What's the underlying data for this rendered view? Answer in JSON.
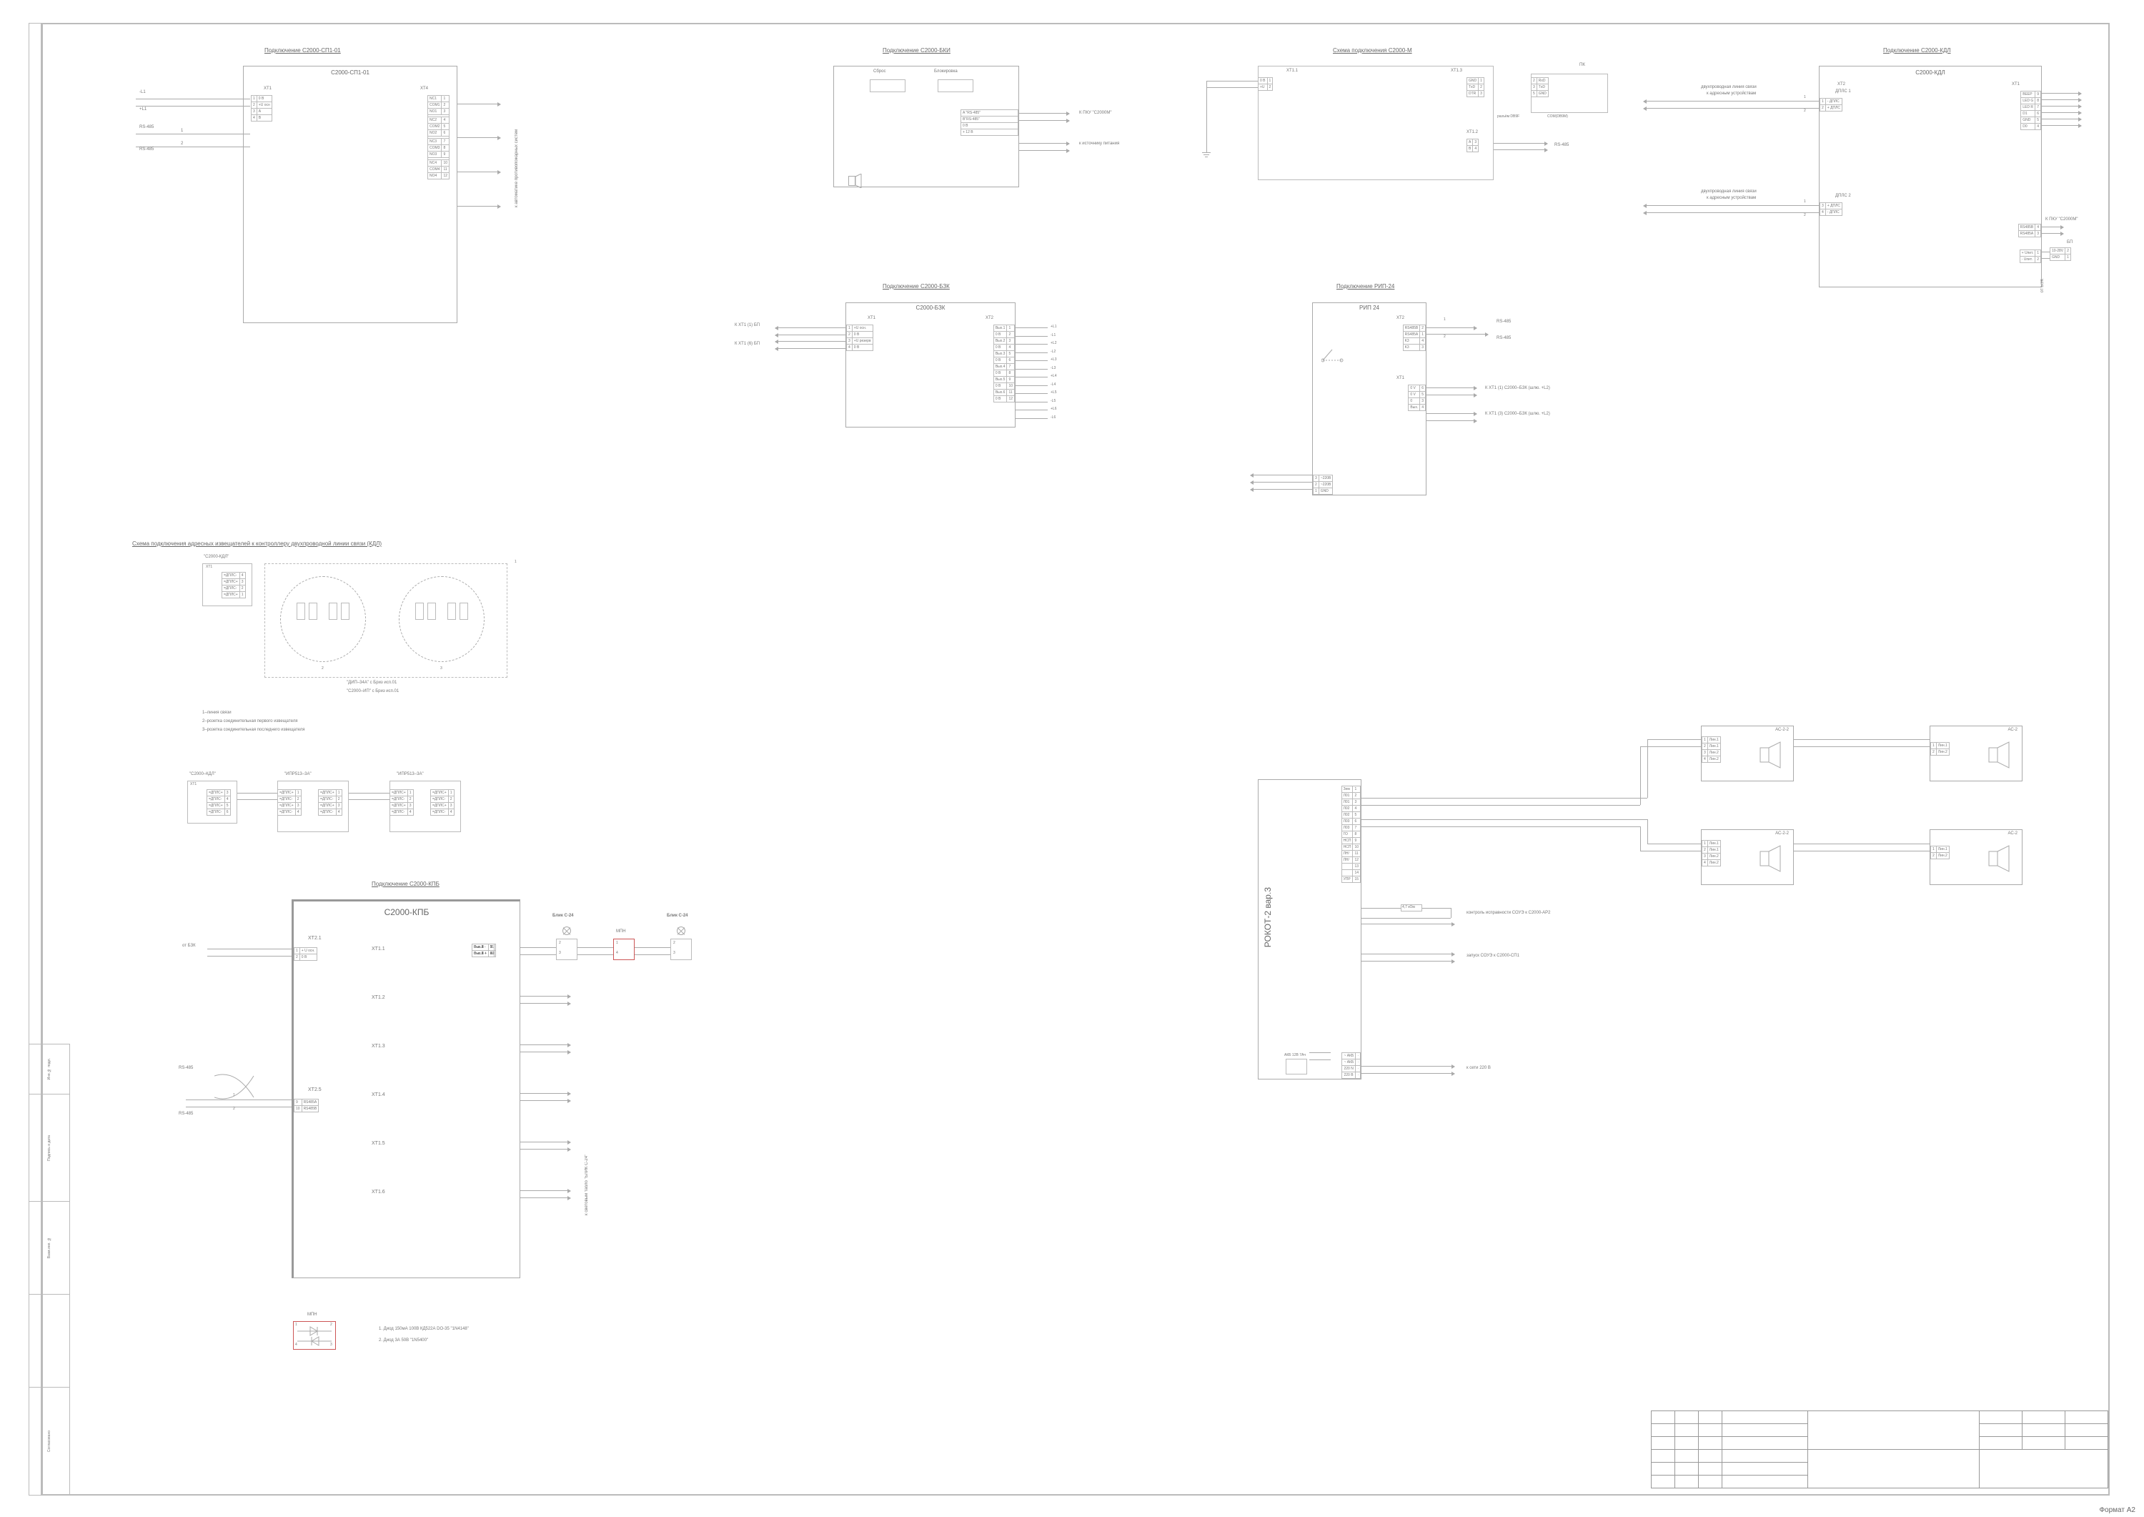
{
  "sheet": {
    "format": "Формат А2"
  },
  "side_labels": [
    "Инв.№ подл.",
    "Подпись и дата",
    "Взам.инв. №",
    "",
    "Согласовано"
  ],
  "sp1": {
    "title": "Подключение С2000-СП1-01",
    "device": "С2000-СП1-01",
    "left_inputs": [
      "-L1",
      "+L1",
      "RS-485",
      "RS-485"
    ],
    "xt1": [
      [
        "1",
        "0 В"
      ],
      [
        "2",
        "+U осн"
      ],
      [
        "3",
        "А"
      ],
      [
        "4",
        "В"
      ]
    ],
    "xt4": [
      [
        "NC1",
        "1"
      ],
      [
        "COM1",
        "2"
      ],
      [
        "NO1",
        "3"
      ],
      [
        "NC2",
        "4"
      ],
      [
        "COM2",
        "5"
      ],
      [
        "NO2",
        "6"
      ],
      [
        "NC3",
        "7"
      ],
      [
        "COM3",
        "8"
      ],
      [
        "NO3",
        "9"
      ],
      [
        "NC4",
        "10"
      ],
      [
        "COM4",
        "11"
      ],
      [
        "NO4",
        "12"
      ]
    ],
    "right_note": "к автоматике противопожарных систем"
  },
  "bki": {
    "title": "Подключение С2000-БКИ",
    "btns": [
      "Сброс",
      "Блокировка"
    ],
    "rows": [
      "A \"RS-485\"",
      "B\"RS-485\"",
      "0 В",
      "+ 12 В"
    ],
    "notes": [
      "К ПКУ \"С2000М\"",
      "",
      "к источнику питания",
      ""
    ]
  },
  "c2000m": {
    "title": "Схема подключения С2000-М",
    "xt11": [
      [
        "0 В",
        "1"
      ],
      [
        "+U",
        "2"
      ]
    ],
    "xt13_left": [
      [
        "GND",
        "1"
      ],
      [
        "TxD",
        "2"
      ],
      [
        "DTR",
        "3"
      ]
    ],
    "xt13_pk": [
      [
        "2",
        "RxD"
      ],
      [
        "3",
        "TxD"
      ],
      [
        "5",
        "GND"
      ]
    ],
    "pk_left": "разъём DB9F",
    "pk_right": "COM(DB9M)",
    "xt12": [
      [
        "A",
        "3"
      ],
      [
        "B",
        "4"
      ]
    ],
    "rs": "RS-485",
    "pk": "ПК"
  },
  "kdl": {
    "title": "Подключение С2000-КДЛ",
    "device": "С2000-КДЛ",
    "note1": "двухпроводная линия связи",
    "note2": "к адресным устройствам",
    "dpls1": "ДПЛС 1",
    "dpls2": "ДПЛС 2",
    "xt2_dpls1": [
      [
        "1",
        "- ДПЛС"
      ],
      [
        "2",
        "+ ДПЛС"
      ]
    ],
    "xt2_dpls2": [
      [
        "3",
        "+ ДПЛС"
      ],
      [
        "4",
        "- ДПЛС"
      ]
    ],
    "xt1": [
      [
        "BEEP",
        "9"
      ],
      [
        "LED G",
        "8"
      ],
      [
        "LED R",
        "7"
      ],
      [
        "D1",
        "6"
      ],
      [
        "GND",
        "5"
      ],
      [
        "D0",
        "4"
      ]
    ],
    "xt1_rs": [
      [
        "RS485B",
        "4"
      ],
      [
        "RS485A",
        "3"
      ]
    ],
    "rs_note": "К ПКУ \"С2000М\"",
    "bp_title": "БП",
    "bp": [
      [
        "+U",
        "1"
      ],
      [
        "GND",
        "2"
      ]
    ],
    "bp_rows": [
      [
        "+ Uпит.",
        "1",
        "10-28V"
      ],
      [
        "- Uпит.",
        "2",
        "GND"
      ]
    ],
    "src": "от БЭК"
  },
  "bzk": {
    "title": "Подключение С2000-БЗК",
    "device": "С2000-БЗК",
    "inputs": [
      "К ХТ1 (1) БП",
      "К ХТ1 (6) БП"
    ],
    "xt1": [
      [
        "1",
        "+U осн."
      ],
      [
        "2",
        "0 В"
      ],
      [
        "3",
        "+U резерв"
      ],
      [
        "4",
        "0 В"
      ]
    ],
    "xt2": [
      [
        "Вых.1",
        "1"
      ],
      [
        "0 В",
        "2"
      ],
      [
        "Вых.2",
        "3"
      ],
      [
        "0 В",
        "4"
      ],
      [
        "Вых.3",
        "5"
      ],
      [
        "0 В",
        "6"
      ],
      [
        "Вых.4",
        "7"
      ],
      [
        "0 В",
        "8"
      ],
      [
        "Вых.5",
        "9"
      ],
      [
        "0 В",
        "10"
      ],
      [
        "Вых.6",
        "11"
      ],
      [
        "0 В",
        "12"
      ]
    ],
    "right": [
      "+L1",
      "-L1",
      "+L2",
      "-L2",
      "+L3",
      "-L3",
      "+L4",
      "-L4",
      "+L5",
      "-L5",
      "+L6",
      "-L6"
    ]
  },
  "rip": {
    "title": "Подключение РИП-24",
    "device": "РИП 24",
    "xt2": [
      [
        "RS485B",
        "2"
      ],
      [
        "RS485A",
        "1"
      ],
      [
        "K3",
        "4"
      ],
      [
        "K3",
        "3"
      ]
    ],
    "xt2_note": [
      "RS-485",
      "RS-485"
    ],
    "xt1": [
      [
        "0 V",
        "6"
      ],
      [
        "0 V",
        "5"
      ],
      [
        "0",
        "3"
      ],
      [
        "Вых.",
        "4"
      ]
    ],
    "xt1_note": [
      "К ХТ1 (1) С2000–БЗК (шлю. +L2)",
      "",
      "К ХТ1 (3) С2000–БЗК (шлю. +L2)",
      ""
    ],
    "bottom": [
      [
        "~220В",
        "1"
      ],
      [
        "~220В",
        "2"
      ],
      [
        "GND",
        "3"
      ]
    ]
  },
  "kdl2": {
    "title": "Схема подключения адресных извещателей к контроллеру двухпроводной линии связи (КДЛ)",
    "dev": "\"С2000-КДЛ\"",
    "xt1": [
      [
        "=ДПЛС-",
        "4"
      ],
      [
        "=ДПЛС+",
        "3"
      ],
      [
        "=ДПЛС-",
        "2"
      ],
      [
        "=ДПЛС+",
        "1"
      ]
    ],
    "det_labels": [
      "\"ДИП–34А\" с Бриз исп.01",
      "\"С2000–ИП\" с Бриз исп.01"
    ],
    "legend": [
      "1–линия связи",
      "2–розетка соединительная первого извещателя",
      "3–розетка соединительная последнего извещателя"
    ]
  },
  "ipr": {
    "dev": "\"С2000–КДЛ\"",
    "ipr_a": "\"ИПР513–3А\"",
    "xt1": [
      [
        "=ДПЛС+",
        "3"
      ],
      [
        "=ДПЛС-",
        "4"
      ],
      [
        "=ДПЛС+",
        "5"
      ],
      [
        "=ДПЛС-",
        "6"
      ]
    ],
    "box": [
      [
        "=ДПЛС+",
        "1"
      ],
      [
        "=ДПЛС-",
        "2"
      ],
      [
        "=ДПЛС+",
        "3"
      ],
      [
        "=ДПЛС-",
        "4"
      ]
    ]
  },
  "kpb": {
    "title": "Подключение С2000-КПБ",
    "device": "С2000-КПБ",
    "from": "от БЗК",
    "xt21": [
      [
        "1",
        "+ U осн."
      ],
      [
        "2",
        "0 В"
      ]
    ],
    "xt25": [
      [
        "9",
        "RS485A"
      ],
      [
        "10",
        "RS485B"
      ]
    ],
    "rs": "RS-485",
    "xts": [
      "XT1.1",
      "XT1.2",
      "XT1.3",
      "XT1.4",
      "XT1.5",
      "XT1.6"
    ],
    "outputs": [
      [
        "Вых.1 -",
        "1"
      ],
      [
        "Вых.1 +",
        "2"
      ],
      [
        "Вых.2 -",
        "3"
      ],
      [
        "Вых.2 +",
        "4"
      ],
      [
        "Вых.3 -",
        "5"
      ],
      [
        "Вых.3 +",
        "6"
      ],
      [
        "Вых.4 -",
        "7"
      ],
      [
        "Вых.4 +",
        "8"
      ],
      [
        "Вых.5 -",
        "9"
      ],
      [
        "Вых.5 +",
        "10"
      ],
      [
        "Вых.6 -",
        "11"
      ],
      [
        "Вых.6 +",
        "12"
      ]
    ],
    "blik": "Блик С-24",
    "mpn": "МПН",
    "right_note": "к световым табло \"БЛИК С-24\"",
    "diodes_title": "МПН",
    "diodes": [
      "1. Диод 150мА 100В КД522А DO-35 \"1N4148\"",
      "2. Диод 3А 50В \"1N5400\""
    ]
  },
  "rokot": {
    "device": "РОКОТ-2 вар.3",
    "pins": [
      [
        "Зем",
        "1"
      ],
      [
        "Л01",
        "2"
      ],
      [
        "Л01",
        "3"
      ],
      [
        "Л02",
        "4"
      ],
      [
        "Л02",
        "5"
      ],
      [
        "Л03",
        "6"
      ],
      [
        "Л03",
        "7"
      ],
      [
        "ГО",
        "8"
      ],
      [
        "НСП",
        "9"
      ],
      [
        "НСП",
        "10"
      ],
      [
        "ЛН/",
        "11"
      ],
      [
        "ЛН/",
        "12"
      ],
      [
        "",
        "13"
      ],
      [
        "",
        "14"
      ],
      [
        "УПР",
        "15"
      ]
    ],
    "bottom_pins": [
      [
        "~ АКБ",
        ""
      ],
      [
        "~ АКБ",
        ""
      ],
      [
        "",
        "220 N"
      ],
      [
        "",
        "220 В"
      ]
    ],
    "res": "4,7 кОм",
    "notes": [
      "контроль исправности СОУЭ к С2000-АР2",
      "запуск СОУЭ к С2000-СП1",
      "к сети 220 В"
    ],
    "speakers": [
      {
        "hdr": "АС-2-2",
        "rows": [
          "Лин.1",
          "Лин.1",
          "Лин.2",
          "Лин.2"
        ]
      },
      {
        "hdr": "АС-2",
        "rows": [
          "Лин.1",
          "Лин.2"
        ]
      }
    ],
    "akb": "АКБ 12В 7Ач"
  },
  "title_block": {
    "cols": 7,
    "rows": 6
  }
}
